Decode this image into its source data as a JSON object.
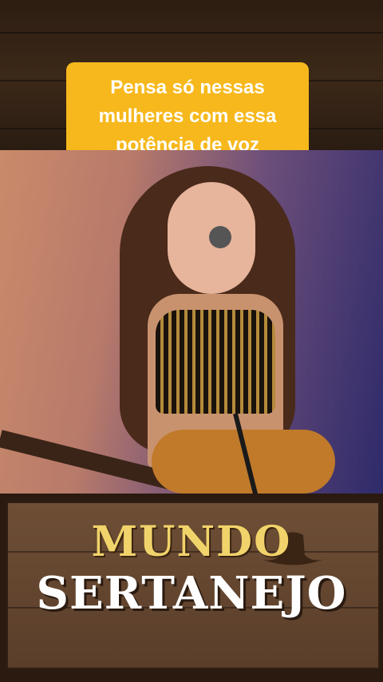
{
  "caption": {
    "text": "Pensa só nessas\nmulheres com essa\npotência de voz",
    "background": "#f6b81c",
    "color": "#ffffff"
  },
  "video": {
    "description_hidden": true
  },
  "sign": {
    "title_top": "MUNDO",
    "title_bottom": "SERTANEJO",
    "title_top_color": "#f1d36b",
    "title_bottom_color": "#ffffff"
  },
  "icons": {
    "hat": "cowboy-hat-icon"
  }
}
